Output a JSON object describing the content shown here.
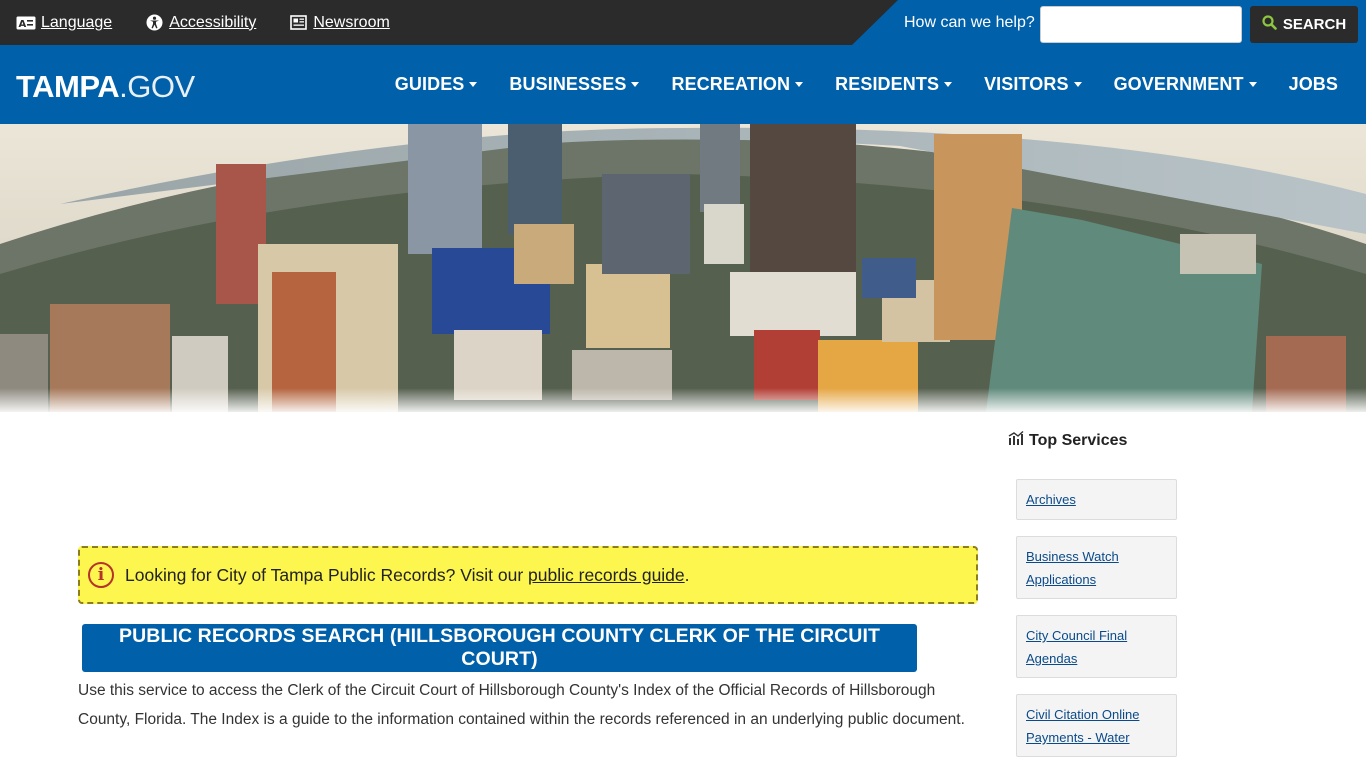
{
  "utility": {
    "links": [
      {
        "label": "Language",
        "icon": "language-icon"
      },
      {
        "label": "Accessibility",
        "icon": "accessibility-icon"
      },
      {
        "label": "Newsroom",
        "icon": "newspaper-icon"
      }
    ],
    "search_label": "How can we help?",
    "search_placeholder": "",
    "search_button": "SEARCH"
  },
  "logo": {
    "bold": "TAMPA",
    "light": ".GOV"
  },
  "nav": {
    "items": [
      {
        "label": "GUIDES",
        "has_menu": true
      },
      {
        "label": "BUSINESSES",
        "has_menu": true
      },
      {
        "label": "RECREATION",
        "has_menu": true
      },
      {
        "label": "RESIDENTS",
        "has_menu": true
      },
      {
        "label": "VISITORS",
        "has_menu": true
      },
      {
        "label": "GOVERNMENT",
        "has_menu": true
      },
      {
        "label": "JOBS",
        "has_menu": false
      }
    ]
  },
  "hero": {
    "image": "tampa-skyline-aerial"
  },
  "notice": {
    "text": "Looking for City of Tampa Public Records? Visit our ",
    "link": "public records guide",
    "end": "."
  },
  "main": {
    "records_button": "PUBLIC RECORDS SEARCH (HILLSBOROUGH COUNTY CLERK OF THE CIRCUIT COURT)",
    "description": "Use this service to access the Clerk of the Circuit Court of Hillsborough County's Index of the Official Records of Hillsborough County, Florida. The Index is a guide to the information contained within the records referenced in an underlying public document."
  },
  "sidebar": {
    "title": "Top Services",
    "items": [
      {
        "label": "Archives"
      },
      {
        "label": "Business Watch Applications"
      },
      {
        "label": "City Council Final Agendas"
      },
      {
        "label": "Civil Citation Online Payments - Water"
      }
    ]
  },
  "colors": {
    "brand_blue": "#0060a9",
    "utility_dark": "#2b2b2b",
    "notice_yellow": "#fdf64f",
    "search_icon_green": "#8dc63f"
  }
}
